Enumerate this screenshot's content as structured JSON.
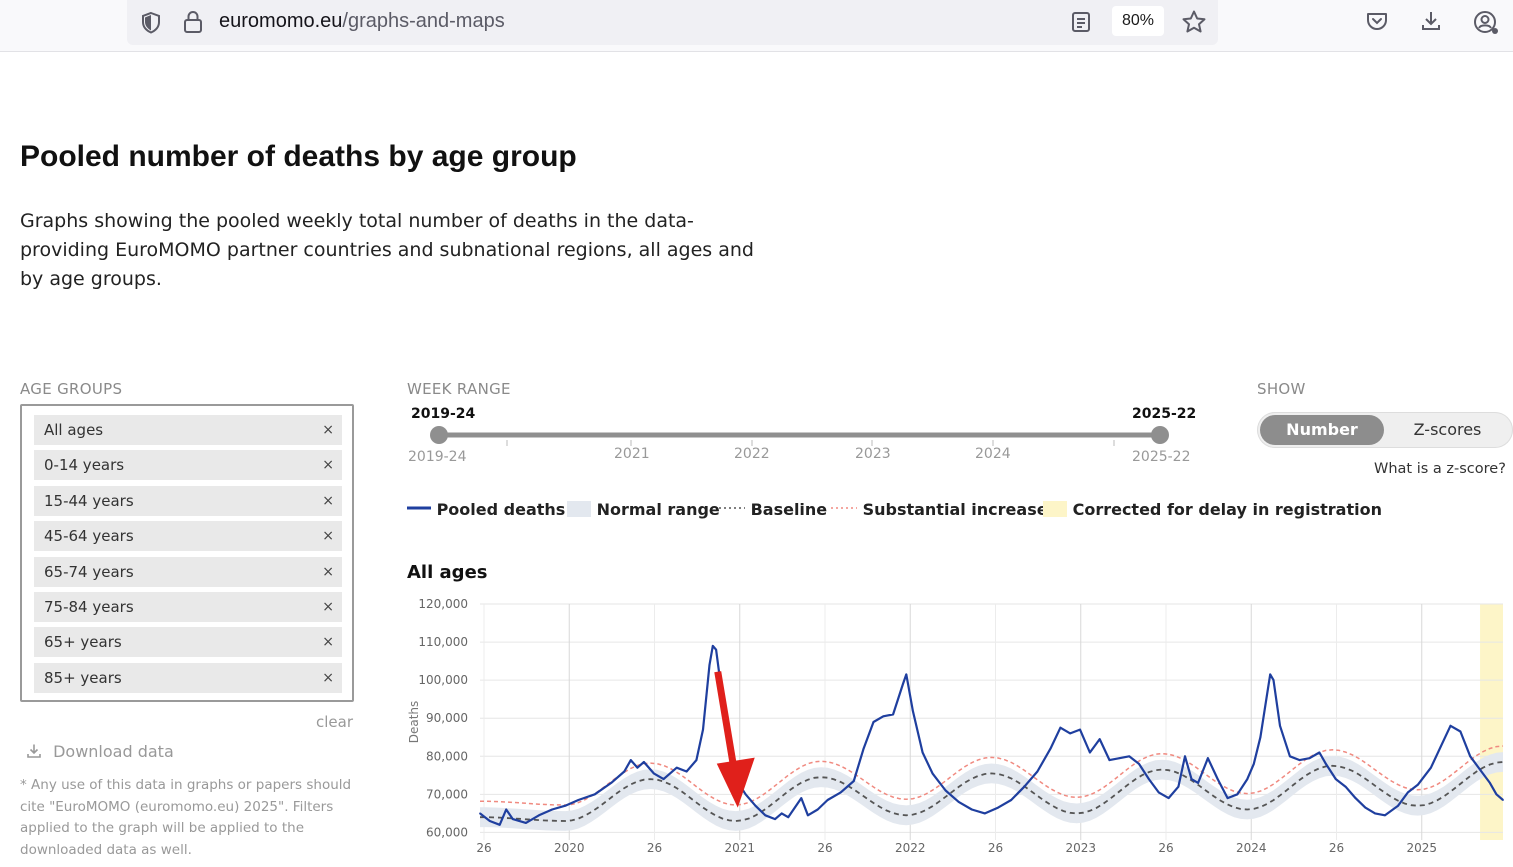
{
  "browser": {
    "url_host": "euromomo.eu",
    "url_path": "/graphs-and-maps",
    "zoom": "80%"
  },
  "page": {
    "title": "Pooled number of deaths by age group",
    "description": "Graphs showing the pooled weekly total number of deaths in the data-providing EuroMOMO partner countries and subnational regions, all ages and by age groups."
  },
  "filters": {
    "age_groups_label": "AGE GROUPS",
    "age_groups": [
      "All ages",
      "0-14 years",
      "15-44 years",
      "45-64 years",
      "65-74 years",
      "75-84 years",
      "65+ years",
      "85+ years"
    ],
    "remove_symbol": "×",
    "clear_label": "clear",
    "download_label": "Download data",
    "note": "* Any use of this data in graphs or papers should cite \"EuroMOMO (euromomo.eu) 2025\". Filters applied to the graph will be applied to the downloaded data as well.",
    "week_range_label": "WEEK RANGE",
    "week_range_start": "2019-24",
    "week_range_end": "2025-22",
    "week_range_min": "2019-24",
    "week_range_max": "2025-22",
    "week_range_ticks": [
      "2021",
      "2022",
      "2023",
      "2024"
    ],
    "show_label": "SHOW",
    "show_options": [
      "Number",
      "Z-scores"
    ],
    "show_selected": "Number",
    "zscore_link": "What is a z-score?"
  },
  "legend": {
    "pooled": "Pooled deaths",
    "normal": "Normal range",
    "baseline": "Baseline",
    "substantial": "Substantial increase",
    "corrected": "Corrected for delay in registration"
  },
  "colors": {
    "pooled": "#1f3f9f",
    "normal_band": "#e3e8ef",
    "baseline": "#555555",
    "substantial": "#f08a80",
    "corrected": "#fdf5c8",
    "annotation_arrow": "#e0201b"
  },
  "chart_data": {
    "type": "line",
    "title": "All ages",
    "ylabel": "Deaths",
    "ylim": [
      58000,
      120000
    ],
    "yticks": [
      "60,000",
      "70,000",
      "80,000",
      "90,000",
      "100,000",
      "110,000",
      "120,000"
    ],
    "x_tick_labels": [
      "26",
      "2020",
      "26",
      "2021",
      "26",
      "2022",
      "26",
      "2023",
      "26",
      "2024",
      "26",
      "2025"
    ],
    "x_unit": "weeks since 2019-24",
    "xlim": [
      0,
      312
    ],
    "corrected_from_x": 305,
    "annotation": "red arrow pointing at 2020 week 26 trough",
    "series": [
      {
        "name": "Pooled deaths",
        "points": [
          [
            0,
            65000
          ],
          [
            3,
            63000
          ],
          [
            6,
            62000
          ],
          [
            8,
            66000
          ],
          [
            10,
            63500
          ],
          [
            14,
            62500
          ],
          [
            18,
            64500
          ],
          [
            22,
            66000
          ],
          [
            26,
            67000
          ],
          [
            30,
            68500
          ],
          [
            35,
            70000
          ],
          [
            40,
            73000
          ],
          [
            44,
            76000
          ],
          [
            46,
            79000
          ],
          [
            48,
            77000
          ],
          [
            50,
            78500
          ],
          [
            53,
            75500
          ],
          [
            56,
            74000
          ],
          [
            60,
            77000
          ],
          [
            63,
            76000
          ],
          [
            66,
            79000
          ],
          [
            68,
            87000
          ],
          [
            70,
            104000
          ],
          [
            71,
            109000
          ],
          [
            72,
            108000
          ],
          [
            74,
            95000
          ],
          [
            76,
            82000
          ],
          [
            78,
            74000
          ],
          [
            81,
            70000
          ],
          [
            84,
            67000
          ],
          [
            87,
            64500
          ],
          [
            90,
            63500
          ],
          [
            92,
            65000
          ],
          [
            94,
            64000
          ],
          [
            96,
            66500
          ],
          [
            98,
            69000
          ],
          [
            100,
            64500
          ],
          [
            103,
            66000
          ],
          [
            106,
            68500
          ],
          [
            110,
            70500
          ],
          [
            114,
            73500
          ],
          [
            117,
            82000
          ],
          [
            120,
            89000
          ],
          [
            123,
            90500
          ],
          [
            126,
            91000
          ],
          [
            129,
            99000
          ],
          [
            130,
            101500
          ],
          [
            132,
            92000
          ],
          [
            135,
            81000
          ],
          [
            138,
            75500
          ],
          [
            142,
            71000
          ],
          [
            146,
            68000
          ],
          [
            150,
            66000
          ],
          [
            154,
            65000
          ],
          [
            158,
            66500
          ],
          [
            162,
            68500
          ],
          [
            166,
            72000
          ],
          [
            170,
            76000
          ],
          [
            174,
            82000
          ],
          [
            177,
            87500
          ],
          [
            180,
            86000
          ],
          [
            183,
            87000
          ],
          [
            186,
            81000
          ],
          [
            189,
            84500
          ],
          [
            192,
            79000
          ],
          [
            195,
            79500
          ],
          [
            198,
            80000
          ],
          [
            201,
            78000
          ],
          [
            204,
            74000
          ],
          [
            207,
            70500
          ],
          [
            210,
            69000
          ],
          [
            213,
            72000
          ],
          [
            215,
            80000
          ],
          [
            217,
            74000
          ],
          [
            219,
            73000
          ],
          [
            222,
            79500
          ],
          [
            225,
            74000
          ],
          [
            228,
            69000
          ],
          [
            231,
            70000
          ],
          [
            234,
            74000
          ],
          [
            236,
            78000
          ],
          [
            238,
            85000
          ],
          [
            240,
            96000
          ],
          [
            241,
            101500
          ],
          [
            242,
            100000
          ],
          [
            244,
            88000
          ],
          [
            247,
            80000
          ],
          [
            250,
            79000
          ],
          [
            253,
            79500
          ],
          [
            256,
            81000
          ],
          [
            258,
            78000
          ],
          [
            261,
            74000
          ],
          [
            264,
            72000
          ],
          [
            267,
            69000
          ],
          [
            270,
            66500
          ],
          [
            273,
            65000
          ],
          [
            276,
            64500
          ],
          [
            280,
            67000
          ],
          [
            283,
            70500
          ],
          [
            286,
            72500
          ],
          [
            290,
            77000
          ],
          [
            293,
            82500
          ],
          [
            296,
            88000
          ],
          [
            299,
            86500
          ],
          [
            302,
            80000
          ],
          [
            305,
            76500
          ],
          [
            308,
            73000
          ],
          [
            310,
            70000
          ],
          [
            312,
            68500
          ]
        ]
      },
      {
        "name": "Baseline",
        "points": [
          [
            0,
            64000
          ],
          [
            26,
            63000
          ],
          [
            52,
            74000
          ],
          [
            78,
            63000
          ],
          [
            104,
            74500
          ],
          [
            130,
            64500
          ],
          [
            156,
            75500
          ],
          [
            182,
            65000
          ],
          [
            208,
            76500
          ],
          [
            234,
            66000
          ],
          [
            260,
            77500
          ],
          [
            286,
            67000
          ],
          [
            312,
            78500
          ]
        ]
      }
    ]
  }
}
